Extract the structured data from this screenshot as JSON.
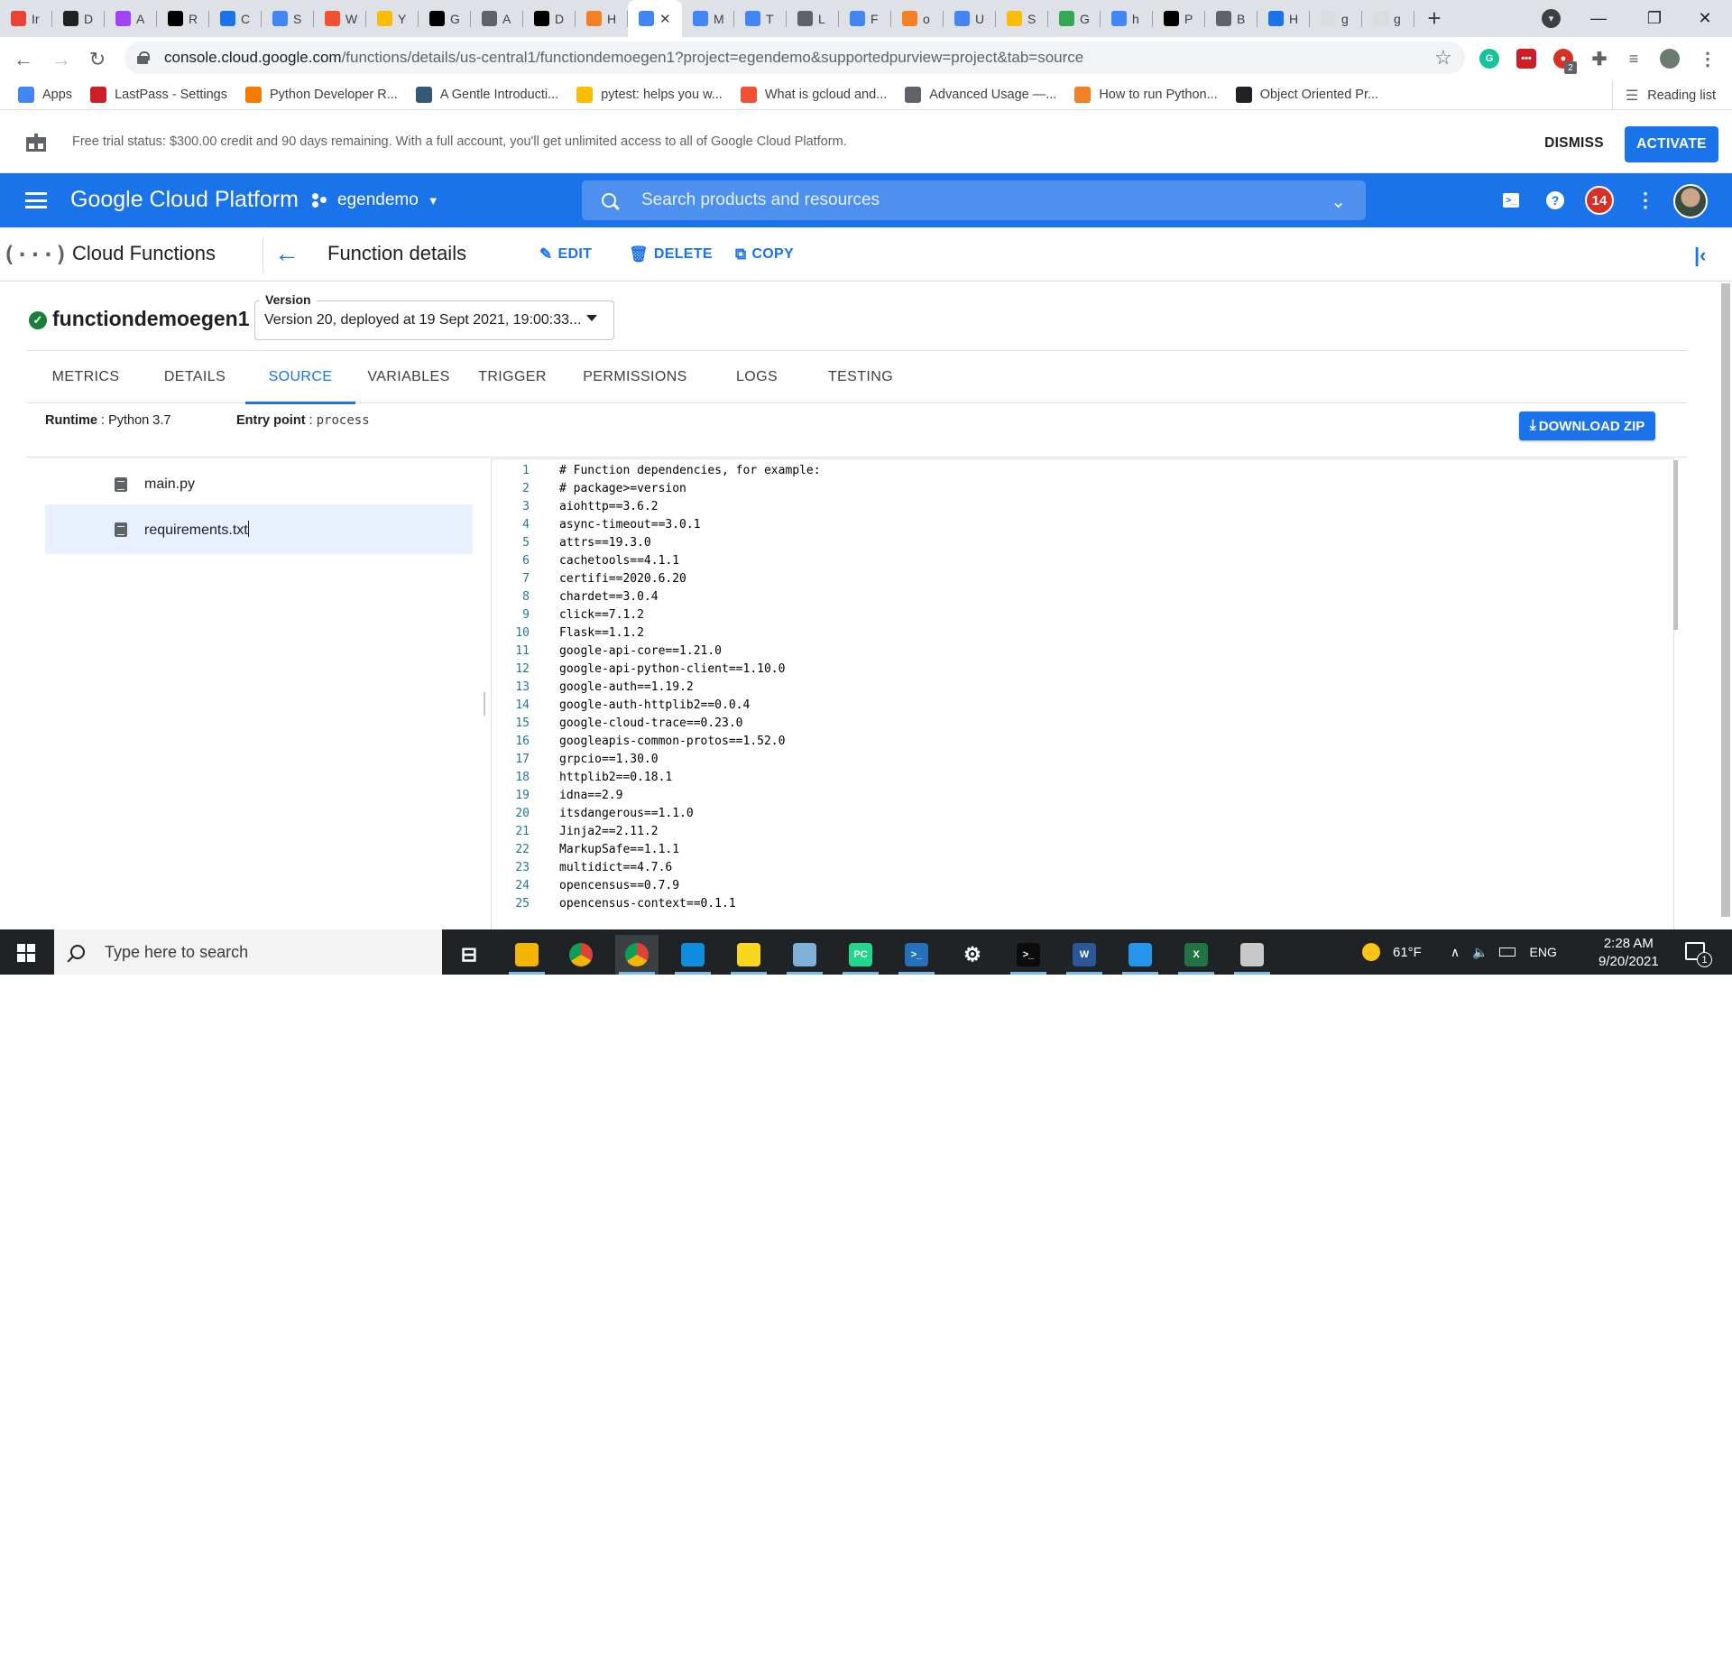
{
  "browser": {
    "tabs": [
      {
        "letter": "Ir",
        "icon": "gmail-icon",
        "color": "#ea4335"
      },
      {
        "letter": "D",
        "icon": "toggle-icon",
        "color": "#202124"
      },
      {
        "letter": "A",
        "icon": "app-icon",
        "color": "#a142f4"
      },
      {
        "letter": "R",
        "icon": "medium-icon",
        "color": "#000000"
      },
      {
        "letter": "C",
        "icon": "gear-blue-icon",
        "color": "#1a73e8"
      },
      {
        "letter": "S",
        "icon": "snowflake-icon",
        "color": "#4285f4"
      },
      {
        "letter": "W",
        "icon": "git-icon",
        "color": "#f05133"
      },
      {
        "letter": "Y",
        "icon": "gcloud-icon",
        "color": "#fbbc04"
      },
      {
        "letter": "G",
        "icon": "jetbrains-icon",
        "color": "#000000"
      },
      {
        "letter": "A",
        "icon": "book-icon",
        "color": "#5f6368"
      },
      {
        "letter": "D",
        "icon": "jetbrains-icon",
        "color": "#000000"
      },
      {
        "letter": "H",
        "icon": "stackoverflow-icon",
        "color": "#f48024"
      },
      {
        "letter": "",
        "icon": "cloud-functions-icon",
        "color": "#4285f4"
      },
      {
        "letter": "M",
        "icon": "gcloud-icon",
        "color": "#4285f4"
      },
      {
        "letter": "T",
        "icon": "snowflake-icon",
        "color": "#4285f4"
      },
      {
        "letter": "L",
        "icon": "github-icon",
        "color": "#5f6368"
      },
      {
        "letter": "F",
        "icon": "cloud-functions-icon",
        "color": "#4285f4"
      },
      {
        "letter": "o",
        "icon": "stackoverflow-icon",
        "color": "#f48024"
      },
      {
        "letter": "U",
        "icon": "gcloud-icon",
        "color": "#4285f4"
      },
      {
        "letter": "S",
        "icon": "gcloud-icon",
        "color": "#fbbc04"
      },
      {
        "letter": "G",
        "icon": "gcloud-icon",
        "color": "#34a853"
      },
      {
        "letter": "h",
        "icon": "google-icon",
        "color": "#4285f4"
      },
      {
        "letter": "P",
        "icon": "dev-icon",
        "color": "#000000"
      },
      {
        "letter": "B",
        "icon": "globe-icon",
        "color": "#5f6368"
      },
      {
        "letter": "H",
        "icon": "history-icon",
        "color": "#1a73e8"
      },
      {
        "letter": "g",
        "icon": "blank-page-icon",
        "color": "#dadce0"
      },
      {
        "letter": "g",
        "icon": "blank-page-icon",
        "color": "#dadce0"
      }
    ],
    "active_tab_index": 12,
    "url_host": "console.cloud.google.com",
    "url_path": "/functions/details/us-central1/functiondemoegen1?project=egendemo&supportedpurview=project&tab=source",
    "bookmarks": [
      {
        "label": "Apps",
        "icon": "apps-grid-icon",
        "color": "#4285f4"
      },
      {
        "label": "LastPass - Settings",
        "icon": "lastpass-icon",
        "color": "#cc2029"
      },
      {
        "label": "Python Developer R...",
        "icon": "chart-icon",
        "color": "#f57c00"
      },
      {
        "label": "A Gentle Introducti...",
        "icon": "tds-icon",
        "color": "#355876"
      },
      {
        "label": "pytest: helps you w...",
        "icon": "pytest-icon",
        "color": "#fbbc04"
      },
      {
        "label": "What is gcloud and...",
        "icon": "git-icon",
        "color": "#f05133"
      },
      {
        "label": "Advanced Usage —...",
        "icon": "book-icon",
        "color": "#5f6368"
      },
      {
        "label": "How to run Python...",
        "icon": "stackoverflow-icon",
        "color": "#f48024"
      },
      {
        "label": "Object Oriented Pr...",
        "icon": "trend-icon",
        "color": "#202124"
      }
    ],
    "reading_list": "Reading list",
    "extension_badge": "2"
  },
  "trial_banner": {
    "text": "Free trial status: $300.00 credit and 90 days remaining. With a full account, you'll get unlimited access to all of Google Cloud Platform.",
    "dismiss": "DISMISS",
    "activate": "ACTIVATE"
  },
  "gcp_header": {
    "title": "Google Cloud Platform",
    "project": "egendemo",
    "search_placeholder": "Search products and resources",
    "notifications_count": "14"
  },
  "product_bar": {
    "product": "Cloud Functions",
    "page_title": "Function details",
    "edit": "EDIT",
    "delete": "DELETE",
    "copy": "COPY"
  },
  "function": {
    "name": "functiondemoegen1",
    "version_label": "Version",
    "version_value": "Version 20, deployed at 19 Sept 2021, 19:00:33..."
  },
  "tabs": [
    {
      "label": "METRICS",
      "active": false
    },
    {
      "label": "DETAILS",
      "active": false
    },
    {
      "label": "SOURCE",
      "active": true
    },
    {
      "label": "VARIABLES",
      "active": false
    },
    {
      "label": "TRIGGER",
      "active": false
    },
    {
      "label": "PERMISSIONS",
      "active": false
    },
    {
      "label": "LOGS",
      "active": false
    },
    {
      "label": "TESTING",
      "active": false
    }
  ],
  "source": {
    "runtime_label": "Runtime",
    "runtime_value": "Python 3.7",
    "entry_label": "Entry point",
    "entry_value": "process",
    "download_label": "DOWNLOAD ZIP",
    "files": [
      {
        "name": "main.py",
        "selected": false
      },
      {
        "name": "requirements.txt",
        "selected": true
      }
    ],
    "code_lines": [
      "# Function dependencies, for example:",
      "# package>=version",
      "aiohttp==3.6.2",
      "async-timeout==3.0.1",
      "attrs==19.3.0",
      "cachetools==4.1.1",
      "certifi==2020.6.20",
      "chardet==3.0.4",
      "click==7.1.2",
      "Flask==1.1.2",
      "google-api-core==1.21.0",
      "google-api-python-client==1.10.0",
      "google-auth==1.19.2",
      "google-auth-httplib2==0.0.4",
      "google-cloud-trace==0.23.0",
      "googleapis-common-protos==1.52.0",
      "grpcio==1.30.0",
      "httplib2==0.18.1",
      "idna==2.9",
      "itsdangerous==1.1.0",
      "Jinja2==2.11.2",
      "MarkupSafe==1.1.1",
      "multidict==4.7.6",
      "opencensus==0.7.9",
      "opencensus-context==0.1.1"
    ]
  },
  "taskbar": {
    "search_placeholder": "Type here to search",
    "apps": [
      {
        "icon": "task-view-icon",
        "color": "#1f2326",
        "glyph": "⊟",
        "active": false,
        "running": false
      },
      {
        "icon": "file-explorer-icon",
        "color": "#f4b400",
        "glyph": "",
        "active": false,
        "running": true
      },
      {
        "icon": "chrome-icon",
        "color": "#db4437",
        "glyph": "",
        "active": false,
        "running": false
      },
      {
        "icon": "chrome-icon",
        "color": "#db4437",
        "glyph": "",
        "active": true,
        "running": true
      },
      {
        "icon": "edge-icon",
        "color": "#0f8ee0",
        "glyph": "",
        "active": false,
        "running": true
      },
      {
        "icon": "sticky-notes-icon",
        "color": "#f9d71c",
        "glyph": "",
        "active": false,
        "running": true
      },
      {
        "icon": "notepad-icon",
        "color": "#7fb2d6",
        "glyph": "",
        "active": false,
        "running": true
      },
      {
        "icon": "pycharm-icon",
        "color": "#21d789",
        "glyph": "PC",
        "active": false,
        "running": true
      },
      {
        "icon": "powershell-icon",
        "color": "#2671be",
        "glyph": ">_",
        "active": false,
        "running": true
      },
      {
        "icon": "settings-icon",
        "color": "#1f2326",
        "glyph": "⚙",
        "active": false,
        "running": false
      },
      {
        "icon": "terminal-icon",
        "color": "#0c0c0c",
        "glyph": ">_",
        "active": false,
        "running": true
      },
      {
        "icon": "word-icon",
        "color": "#2b579a",
        "glyph": "W",
        "active": false,
        "running": true
      },
      {
        "icon": "docker-icon",
        "color": "#2496ed",
        "glyph": "",
        "active": false,
        "running": true
      },
      {
        "icon": "excel-icon",
        "color": "#217346",
        "glyph": "X",
        "active": false,
        "running": true
      },
      {
        "icon": "paint-icon",
        "color": "#c8c8c8",
        "glyph": "",
        "active": false,
        "running": true
      }
    ],
    "temperature": "61°F",
    "language": "ENG",
    "time": "2:28 AM",
    "date": "9/20/2021",
    "notification_count": "1"
  }
}
